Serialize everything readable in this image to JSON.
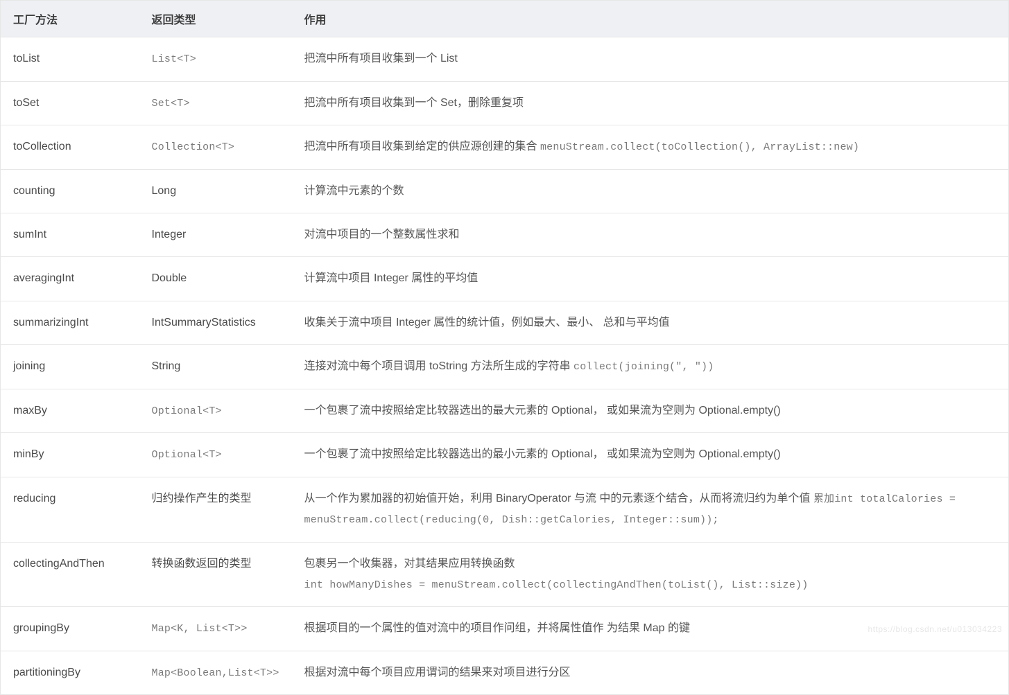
{
  "headers": {
    "method": "工厂方法",
    "type": "返回类型",
    "desc": "作用"
  },
  "rows": [
    {
      "method": "toList",
      "type": "List<T>",
      "type_mono": true,
      "desc": "把流中所有项目收集到一个 List"
    },
    {
      "method": "toSet",
      "type": "Set<T>",
      "type_mono": true,
      "desc": "把流中所有项目收集到一个 Set，删除重复项"
    },
    {
      "method": "toCollection",
      "type": "Collection<T>",
      "type_mono": true,
      "desc": "把流中所有项目收集到给定的供应源创建的集合 ",
      "code": "menuStream.collect(toCollection(), ArrayList::new)"
    },
    {
      "method": "counting",
      "type": "Long",
      "type_mono": false,
      "desc": "计算流中元素的个数"
    },
    {
      "method": "sumInt",
      "type": "Integer",
      "type_mono": false,
      "desc": "对流中项目的一个整数属性求和"
    },
    {
      "method": "averagingInt",
      "type": "Double",
      "type_mono": false,
      "desc": "计算流中项目 Integer 属性的平均值"
    },
    {
      "method": "summarizingInt",
      "type": "IntSummaryStatistics",
      "type_mono": false,
      "desc": "收集关于流中项目 Integer 属性的统计值，例如最大、最小、 总和与平均值"
    },
    {
      "method": "joining",
      "type": "String",
      "type_mono": false,
      "desc": "连接对流中每个项目调用 toString 方法所生成的字符串 ",
      "code": "collect(joining(\", \"))"
    },
    {
      "method": "maxBy",
      "type": "Optional<T>",
      "type_mono": true,
      "desc": "一个包裹了流中按照给定比较器选出的最大元素的 Optional， 或如果流为空则为 Optional.empty()"
    },
    {
      "method": "minBy",
      "type": "Optional<T>",
      "type_mono": true,
      "desc": "一个包裹了流中按照给定比较器选出的最小元素的 Optional， 或如果流为空则为 Optional.empty()"
    },
    {
      "method": "reducing",
      "type": "归约操作产生的类型",
      "type_mono": false,
      "desc": "从一个作为累加器的初始值开始，利用 BinaryOperator 与流 中的元素逐个结合，从而将流归约为单个值 ",
      "prefix_code": "累加",
      "code": "int totalCalories = menuStream.collect(reducing(0, Dish::getCalories, Integer::sum));"
    },
    {
      "method": "collectingAndThen",
      "type": "转换函数返回的类型",
      "type_mono": false,
      "desc": "包裹另一个收集器，对其结果应用转换函数 ",
      "code": " int howManyDishes = menuStream.collect(collectingAndThen(toList(), List::size))",
      "code_newline": true
    },
    {
      "method": "groupingBy",
      "type": "Map<K, List<T>>",
      "type_mono": true,
      "desc": "根据项目的一个属性的值对流中的项目作问组，并将属性值作 为结果 Map 的键"
    },
    {
      "method": "partitioningBy",
      "type": "Map<Boolean,List<T>>",
      "type_mono": true,
      "desc": "根据对流中每个项目应用谓词的结果来对项目进行分区"
    }
  ],
  "watermark": "https://blog.csdn.net/u013034223"
}
